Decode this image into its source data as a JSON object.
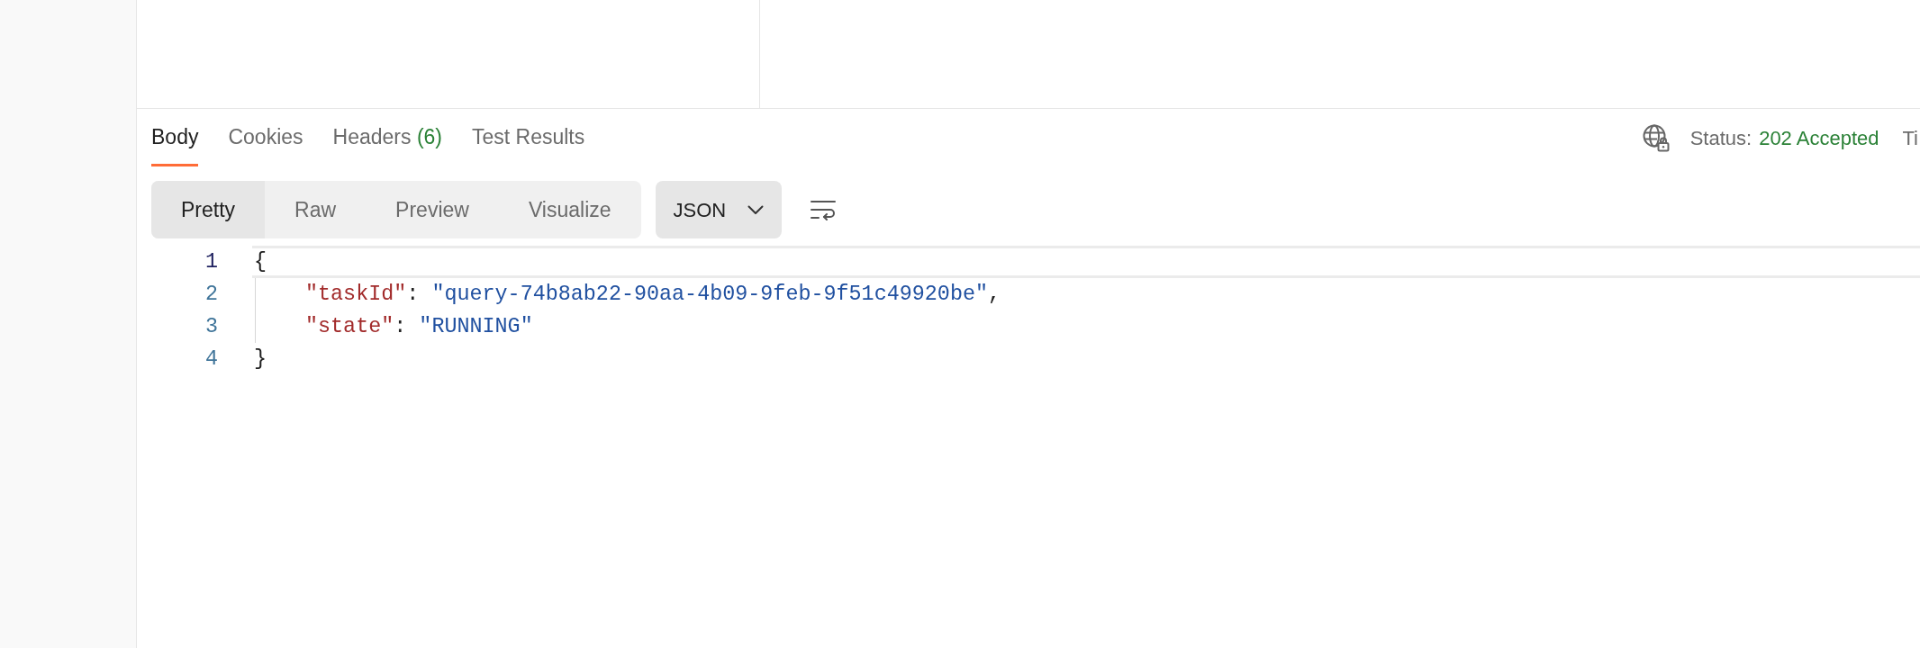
{
  "response_tabs": [
    {
      "label": "Body",
      "selected": true
    },
    {
      "label": "Cookies",
      "selected": false
    },
    {
      "label": "Headers",
      "count": "(6)",
      "selected": false
    },
    {
      "label": "Test Results",
      "selected": false
    }
  ],
  "status": {
    "label": "Status:",
    "value": "202 Accepted"
  },
  "cut_off_label": "Ti",
  "view_modes": [
    {
      "label": "Pretty",
      "selected": true
    },
    {
      "label": "Raw",
      "selected": false
    },
    {
      "label": "Preview",
      "selected": false
    },
    {
      "label": "Visualize",
      "selected": false
    }
  ],
  "format_dropdown": {
    "value": "JSON"
  },
  "code_lines": [
    {
      "number": "1",
      "active": true,
      "tokens": [
        {
          "kind": "brace",
          "text": "{"
        }
      ],
      "children": [
        {
          "number": "2",
          "active": false,
          "tokens": [
            {
              "kind": "key",
              "text": "\"taskId\""
            },
            {
              "kind": "colon",
              "text": ":"
            },
            {
              "kind": "string",
              "text": "\"query-74b8ab22-90aa-4b09-9feb-9f51c49920be\""
            },
            {
              "kind": "comma",
              "text": ","
            }
          ]
        },
        {
          "number": "3",
          "active": false,
          "tokens": [
            {
              "kind": "key",
              "text": "\"state\""
            },
            {
              "kind": "colon",
              "text": ":"
            },
            {
              "kind": "string",
              "text": "\"RUNNING\""
            }
          ]
        }
      ]
    },
    {
      "number": "4",
      "active": false,
      "tokens": [
        {
          "kind": "brace",
          "text": "}"
        }
      ]
    }
  ]
}
